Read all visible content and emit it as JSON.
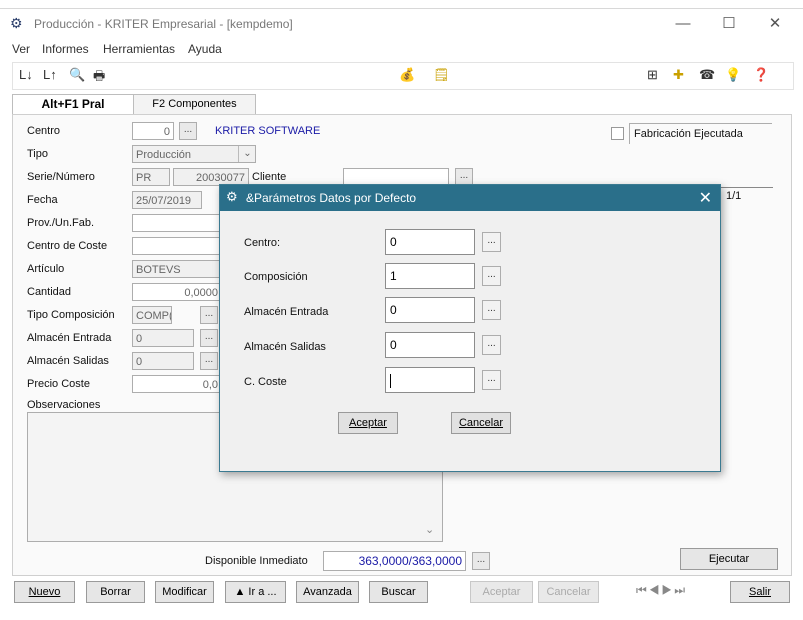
{
  "window": {
    "title": "Producción - KRITER Empresarial - [kempdemo]",
    "minimize": "—",
    "maximize": "☐",
    "close": "✕"
  },
  "menu": [
    "Ver",
    "Informes",
    "Herramientas",
    "Ayuda"
  ],
  "tabs": [
    {
      "label": "Alt+F1 Pral",
      "active": true
    },
    {
      "label": "F2 Componentes",
      "active": false
    }
  ],
  "form": {
    "centro_label": "Centro",
    "centro_value": "0",
    "centro_name": "KRITER SOFTWARE",
    "fabricacion_label": "Fabricación Ejecutada",
    "tipo_label": "Tipo",
    "tipo_value": "Producción",
    "serie_label": "Serie/Número",
    "serie_value": "PR",
    "numero_value": "20030077",
    "cliente_label": "Cliente",
    "fecha_label": "Fecha",
    "fecha_value": "25/07/2019",
    "page_indicator": "1/1",
    "prov_label": "Prov./Un.Fab.",
    "coste_label": "Centro de Coste",
    "articulo_label": "Artículo",
    "articulo_value": "BOTEVS",
    "cantidad_label": "Cantidad",
    "cantidad_value": "0,0000",
    "tipocomp_label": "Tipo Composición",
    "tipocomp_value": "COMP(",
    "almentrada_label": "Almacén Entrada",
    "almentrada_value": "0",
    "almsalidas_label": "Almacén Salidas",
    "almsalidas_value": "0",
    "precio_label": "Precio Coste",
    "precio_value": "0,0",
    "obs_label": "Observaciones",
    "disponible_label": "Disponible Inmediato",
    "disponible_value": "363,0000/363,0000",
    "ejecutar_label": "Ejecutar"
  },
  "bottom_buttons": [
    {
      "label": "Nuevo",
      "enabled": true
    },
    {
      "label": "Borrar",
      "enabled": true
    },
    {
      "label": "Modificar",
      "enabled": true
    },
    {
      "label": "▲ Ir a ...",
      "enabled": true
    },
    {
      "label": "Avanzada",
      "enabled": true
    },
    {
      "label": "Buscar",
      "enabled": true
    },
    {
      "label": "Aceptar",
      "enabled": false
    },
    {
      "label": "Cancelar",
      "enabled": false
    },
    {
      "label": "Salir",
      "enabled": true
    }
  ],
  "dialog": {
    "title": "&Parámetros Datos por Defecto",
    "fields": [
      {
        "label": "Centro:",
        "value": "0"
      },
      {
        "label": "Composición",
        "value": "1"
      },
      {
        "label": "Almacén Entrada",
        "value": "0"
      },
      {
        "label": "Almacén Salidas",
        "value": "0"
      },
      {
        "label": "C. Coste",
        "value": ""
      }
    ],
    "accept_label": "Aceptar",
    "cancel_label": "Cancelar"
  },
  "dots": "..."
}
